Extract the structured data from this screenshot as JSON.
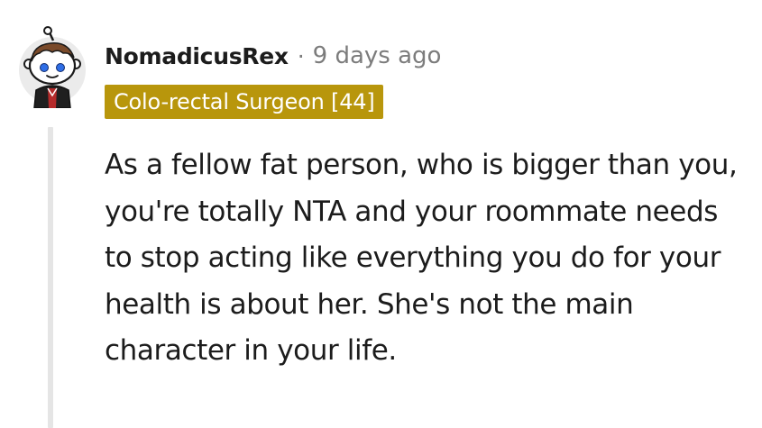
{
  "comment": {
    "username": "NomadicusRex",
    "separator": "·",
    "timestamp": "9 days ago",
    "flair": "Colo-rectal Surgeon [44]",
    "body": "As a fellow fat person, who is bigger than you, you're totally NTA and your roommate needs to stop acting like everything you do for your health is about her. She's not the main character in your life.",
    "avatar_icon": "snoo-avatar-icon"
  },
  "colors": {
    "flair_background": "#b8960c",
    "flair_text": "#ffffff",
    "username": "#1c1c1c",
    "meta_text": "#7c7c7c",
    "thread_line": "#e5e5e5"
  }
}
